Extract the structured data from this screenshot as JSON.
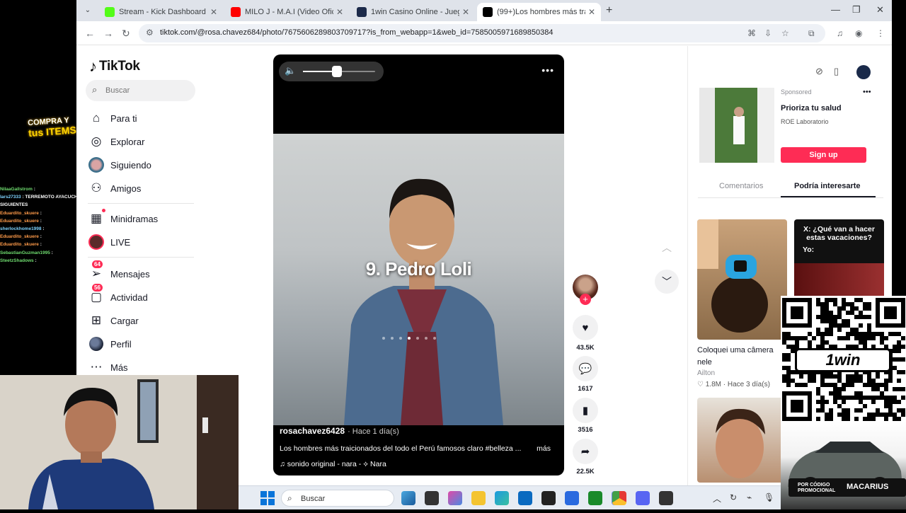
{
  "stream": {
    "promo_line1": "COMPRA Y",
    "promo_line2": "tus ITEMS",
    "chat": [
      {
        "user": "NilaaGallstrom",
        "msg": ":"
      },
      {
        "user": "lars27333",
        "msg": ": TERREMOTO AYACUCHO"
      },
      {
        "user": "",
        "msg": "SIGUIENTES"
      },
      {
        "user": "Eduardito_skuere",
        "msg": ":"
      },
      {
        "user": "Eduardito_skuere",
        "msg": ":"
      },
      {
        "user": "sherlockhome1998",
        "msg": ":"
      },
      {
        "user": "Eduardito_skuere",
        "msg": ":"
      },
      {
        "user": "Eduardito_skuere",
        "msg": ":"
      },
      {
        "user": "SebastianGuzman1995",
        "msg": ":"
      },
      {
        "user": "SteetzShadows",
        "msg": ":"
      }
    ]
  },
  "browser": {
    "tabs": [
      {
        "title": "Stream - Kick Dashboard",
        "color": "#53fc18"
      },
      {
        "title": "MILO J - M.A.I (Video Oficial)",
        "color": "#ff0000"
      },
      {
        "title": "1win Casino Online - Juega y g",
        "color": "#1c2a4a"
      },
      {
        "title": "(99+)Los hombres más traicion",
        "color": "#000000"
      }
    ],
    "url": "tiktok.com/@rosa.chavez684/photo/7675606289803709717?is_from_webapp=1&web_id=7585005971689850384"
  },
  "tiktok": {
    "logo": "TikTok",
    "search_placeholder": "Buscar",
    "nav": [
      {
        "label": "Para ti",
        "icon": "home-icon"
      },
      {
        "label": "Explorar",
        "icon": "compass-icon"
      },
      {
        "label": "Siguiendo",
        "icon": "following-avatar-icon"
      },
      {
        "label": "Amigos",
        "icon": "friends-icon"
      },
      {
        "label": "Minidramas",
        "icon": "minidramas-icon"
      },
      {
        "label": "LIVE",
        "icon": "live-icon"
      },
      {
        "label": "Mensajes",
        "icon": "messages-icon",
        "badge": "64"
      },
      {
        "label": "Actividad",
        "icon": "activity-icon",
        "badge": "56"
      },
      {
        "label": "Cargar",
        "icon": "upload-icon"
      },
      {
        "label": "Perfil",
        "icon": "profile-avatar-icon"
      },
      {
        "label": "Más",
        "icon": "more-icon"
      }
    ],
    "video": {
      "overlay_text": "9. Pedro Loli",
      "author": "rosachavez6428",
      "time": "· Hace 1 día(s)",
      "description": "Los hombres más traicionados del todo el Perú famosos claro #belleza ...",
      "more": "más",
      "sound": "sonido original - nara - ⟡ Nara",
      "volume": 0.47
    },
    "actions": {
      "likes": "43.5K",
      "comments": "1617",
      "saves": "3516",
      "shares": "22.5K"
    },
    "ad": {
      "sponsored": "Sponsored",
      "title": "Prioriza tu salud",
      "brand": "ROE Laboratorio",
      "cta": "Sign up"
    },
    "right_tabs": {
      "comments": "Comentarios",
      "interest": "Podría interesarte"
    },
    "card1": {
      "title": "Coloquei uma câmera nele",
      "author": "Ailton",
      "likes": "1.8M",
      "time": "· Hace 3 día(s)"
    },
    "card2": {
      "line1": "X: ¿Qué van a hacer estas vacaciones?",
      "line2": "Yo:"
    }
  },
  "overlay": {
    "brand": "1win",
    "promo_code_label": "POR CÓDIGO PROMOCIONAL",
    "promo_name": "MACARIUS"
  },
  "taskbar": {
    "search": "Buscar"
  }
}
